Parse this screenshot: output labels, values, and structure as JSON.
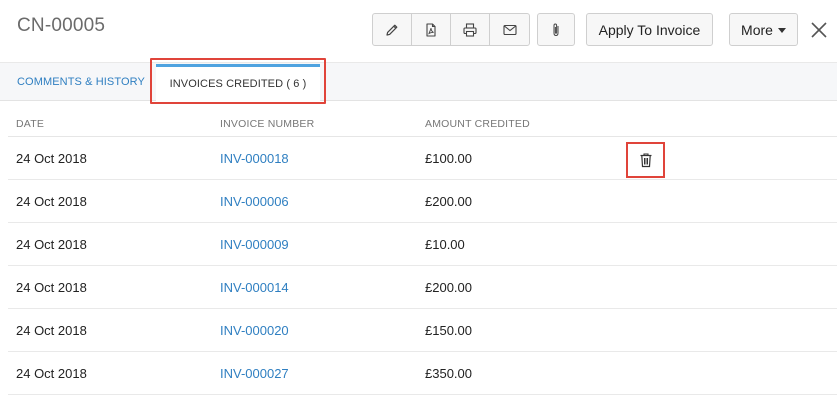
{
  "header": {
    "title": "CN-00005",
    "toolbar_icons": [
      "edit-icon",
      "pdf-icon",
      "print-icon",
      "email-icon",
      "attachment-icon"
    ],
    "apply_label": "Apply To Invoice",
    "more_label": "More"
  },
  "tabs": {
    "comments_label": "COMMENTS & HISTORY",
    "invoices_label": "INVOICES CREDITED ( 6 )"
  },
  "table": {
    "headers": {
      "date": "DATE",
      "invoice": "INVOICE NUMBER",
      "amount": "AMOUNT CREDITED"
    },
    "rows": [
      {
        "date": "24 Oct 2018",
        "invoice": "INV-000018",
        "amount": "£100.00"
      },
      {
        "date": "24 Oct 2018",
        "invoice": "INV-000006",
        "amount": "£200.00"
      },
      {
        "date": "24 Oct 2018",
        "invoice": "INV-000009",
        "amount": "£10.00"
      },
      {
        "date": "24 Oct 2018",
        "invoice": "INV-000014",
        "amount": "£200.00"
      },
      {
        "date": "24 Oct 2018",
        "invoice": "INV-000020",
        "amount": "£150.00"
      },
      {
        "date": "24 Oct 2018",
        "invoice": "INV-000027",
        "amount": "£350.00"
      }
    ]
  },
  "colors": {
    "link": "#2f7fc1",
    "tab_accent": "#4fa3e0",
    "highlight": "#e0443a"
  }
}
